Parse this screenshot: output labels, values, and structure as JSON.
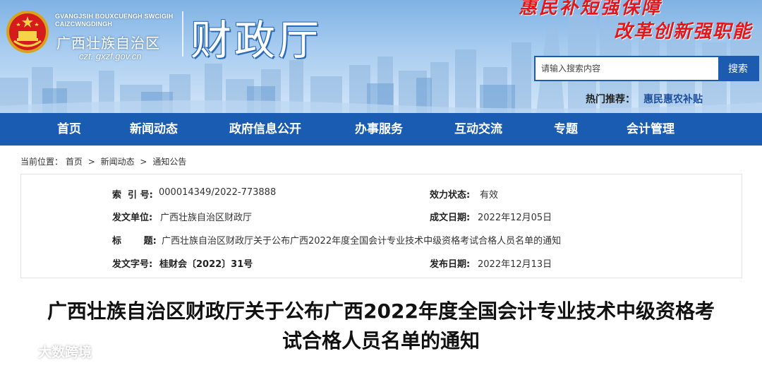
{
  "header": {
    "pinyin_line1": "GVANGJSIH BOUXCUENGH SWCIGIH",
    "pinyin_line2": "CAIZCWNGDINGH",
    "site_name": "广西壮族自治区",
    "domain": "czt. gxzf.gov.cn",
    "department": "财政厅",
    "slogan_top": "惠民补短强保障",
    "slogan_bottom": "改革创新强职能",
    "colors": {
      "banner_blue": "#1b5cb3",
      "slogan_red": "#e3171b"
    }
  },
  "search": {
    "placeholder": "请输入搜索内容",
    "button_label": "搜索",
    "hot_label": "热门推荐：",
    "hot_link": "惠民惠农补贴"
  },
  "nav": {
    "items": [
      {
        "label": "首页"
      },
      {
        "label": "新闻动态"
      },
      {
        "label": "政府信息公开"
      },
      {
        "label": "办事服务"
      },
      {
        "label": "互动交流"
      },
      {
        "label": "专题"
      },
      {
        "label": "会计管理"
      }
    ]
  },
  "breadcrumb": {
    "prefix": "当前位置：",
    "items": [
      "首页",
      "新闻动态",
      "通知公告"
    ],
    "separator": ">"
  },
  "info": {
    "index_label": "索  引 号:",
    "index_value": "000014349/2022-773888",
    "validity_label": "效力状态:",
    "validity_value": "有效",
    "issuer_label": "发文单位:",
    "issuer_value": "广西壮族自治区财政厅",
    "created_label": "成文日期:",
    "created_value": "2022年12月05日",
    "title_label": "标       题:",
    "title_value": "广西壮族自治区财政厅关于公布广西2022年度全国会计专业技术中级资格考试合格人员名单的通知",
    "docno_label": "发文字号:",
    "docno_value": "桂财会〔2022〕31号",
    "published_label": "发布日期:",
    "published_value": "2022年12月13日"
  },
  "article": {
    "title_line1": "广西壮族自治区财政厅关于公布广西2022年度全国会计专业技术中级资格考",
    "title_line2": "试合格人员名单的通知"
  },
  "watermark": {
    "text": "大数跨境",
    "icon": "chat-bubble-icon"
  }
}
